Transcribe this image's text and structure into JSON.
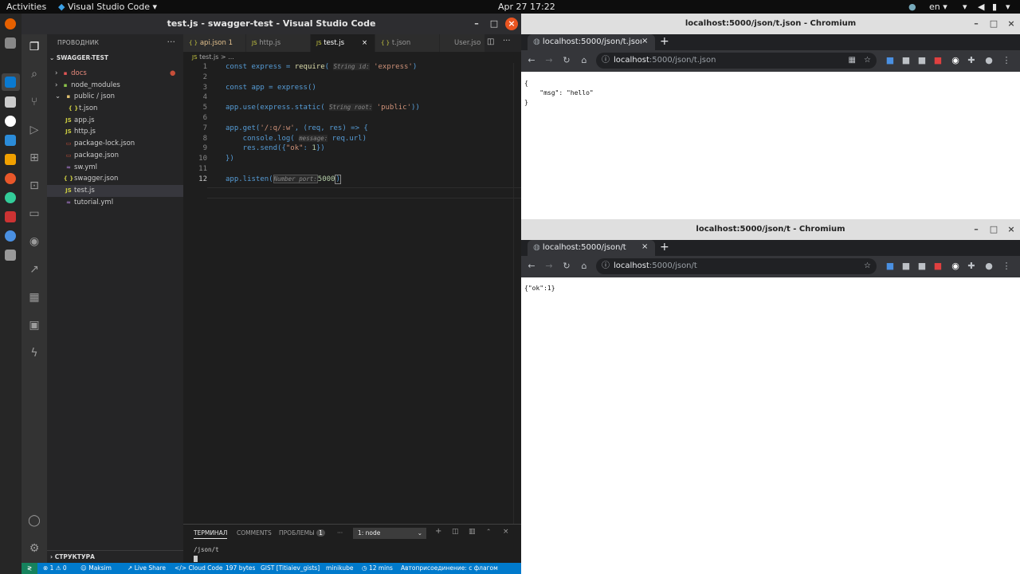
{
  "topbar": {
    "activities": "Activities",
    "app": "Visual Studio Code",
    "clock": "Apr 27  17:22",
    "lang": "en"
  },
  "vscode": {
    "title": "test.js - swagger-test - Visual Studio Code",
    "explorer": {
      "header": "ПРОВОДНИК",
      "more": "···",
      "root": "SWAGGER-TEST",
      "outline": "СТРУКТУРА",
      "items": [
        {
          "type": "folder",
          "name": "docs",
          "glyph": "›",
          "icon": "▪"
        },
        {
          "type": "folder",
          "name": "node_modules",
          "glyph": "›",
          "icon": "▪"
        },
        {
          "type": "folder",
          "name": "public / json",
          "glyph": "⌄",
          "icon": "▪"
        },
        {
          "type": "file",
          "name": "t.json",
          "icon": "{ }"
        },
        {
          "type": "file",
          "name": "app.js",
          "icon": "JS"
        },
        {
          "type": "file",
          "name": "http.js",
          "icon": "JS"
        },
        {
          "type": "file",
          "name": "package-lock.json",
          "icon": "▭"
        },
        {
          "type": "file",
          "name": "package.json",
          "icon": "▭"
        },
        {
          "type": "file",
          "name": "sw.yml",
          "icon": "≈"
        },
        {
          "type": "file",
          "name": "swagger.json",
          "icon": "{ }"
        },
        {
          "type": "file",
          "name": "test.js",
          "icon": "JS"
        },
        {
          "type": "file",
          "name": "tutorial.yml",
          "icon": "≈"
        }
      ]
    },
    "tabs": [
      {
        "icon": "{ }",
        "label": "api.json",
        "badge": "1"
      },
      {
        "icon": "JS",
        "label": "http.js",
        "badge": ""
      },
      {
        "icon": "JS",
        "label": "test.js",
        "badge": "×"
      },
      {
        "icon": "{ }",
        "label": "t.json",
        "badge": ""
      },
      {
        "icon": "",
        "label": "User.jso",
        "badge": ""
      }
    ],
    "breadcrumb": {
      "file_icon": "JS",
      "file": "test.js",
      "sep": "> ..."
    },
    "code": {
      "line_numbers": [
        "1",
        "2",
        "3",
        "4",
        "5",
        "6",
        "7",
        "8",
        "9",
        "10",
        "11",
        "12"
      ],
      "l1": {
        "a": "const express = ",
        "b": "require",
        "c": "(",
        "hint": "String id:",
        "d": "'express'",
        "e": ")"
      },
      "l3": {
        "a": "const app = express()"
      },
      "l5": {
        "a": "app.use(express.static(",
        "hint": "String root:",
        "b": "'public'",
        "c": "))"
      },
      "l7": {
        "a": "app.get(",
        "b": "'/:q/:w'",
        "c": ", (req, res) => {"
      },
      "l8": {
        "a": "    console.log(",
        "hint": "message:",
        "b": "req.url)"
      },
      "l9": {
        "a": "    res.send({",
        "b": "\"ok\"",
        "c": ": ",
        "d": "1",
        "e": "})"
      },
      "l10": {
        "a": "})"
      },
      "l12": {
        "a": "app.listen(",
        "hint": "Number port:",
        "b": "5000",
        "c": ")"
      }
    },
    "terminal": {
      "tabs": [
        "ТЕРМИНАЛ",
        "COMMENTS",
        "ПРОБЛЕМЫ"
      ],
      "problems_count": "1",
      "more": "···",
      "select": "1: node",
      "output": "/json/t"
    },
    "statusbar": {
      "items": [
        "⊗ 1 ⚠ 0",
        "Maksim",
        "Live Share",
        "Cloud Code",
        "197 bytes",
        "GIST [Titiaiev_gists]",
        "minikube",
        "12 mins",
        "Автоприсоединение: с флагом"
      ]
    }
  },
  "chrome1": {
    "title": "localhost:5000/json/t.json - Chromium",
    "tab": "localhost:5000/json/t.json",
    "url_host": "localhost",
    "url_path": ":5000/json/t.json",
    "content": [
      "{",
      "    \"msg\": \"hello\"",
      "}"
    ]
  },
  "chrome2": {
    "title": "localhost:5000/json/t - Chromium",
    "tab": "localhost:5000/json/t",
    "url_host": "localhost",
    "url_path": ":5000/json/t",
    "content": [
      "{\"ok\":1}"
    ]
  }
}
